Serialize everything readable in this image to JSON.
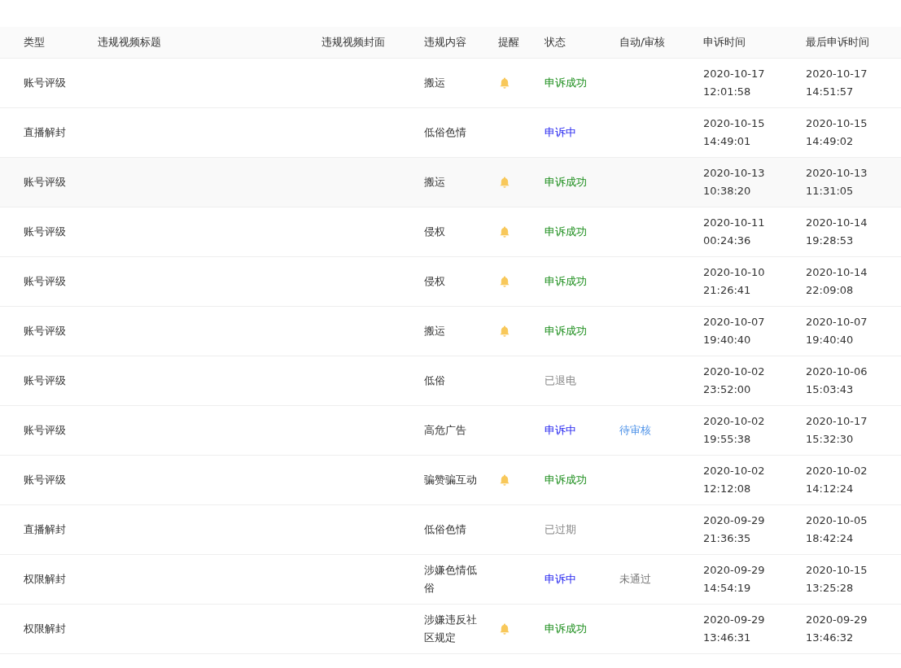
{
  "table": {
    "columns": [
      "类型",
      "违规视频标题",
      "违规视频封面",
      "违规内容",
      "提醒",
      "状态",
      "自动/审核",
      "申诉时间",
      "最后申诉时间"
    ],
    "rows": [
      {
        "type": "账号评级",
        "content": "搬运",
        "remind": true,
        "status": {
          "text": "申诉成功",
          "kind": "success"
        },
        "appeal_time": [
          "2020-10-17",
          "12:01:58"
        ],
        "last_time": [
          "2020-10-17",
          "14:51:57"
        ],
        "highlighted": false
      },
      {
        "type": "直播解封",
        "content": "低俗色情",
        "remind": false,
        "status": {
          "text": "申诉中",
          "kind": "pending"
        },
        "appeal_time": [
          "2020-10-15",
          "14:49:01"
        ],
        "last_time": [
          "2020-10-15",
          "14:49:02"
        ],
        "highlighted": false
      },
      {
        "type": "账号评级",
        "content": "搬运",
        "remind": true,
        "status": {
          "text": "申诉成功",
          "kind": "success"
        },
        "appeal_time": [
          "2020-10-13",
          "10:38:20"
        ],
        "last_time": [
          "2020-10-13",
          "11:31:05"
        ],
        "highlighted": true
      },
      {
        "type": "账号评级",
        "content": "侵权",
        "remind": true,
        "status": {
          "text": "申诉成功",
          "kind": "success"
        },
        "appeal_time": [
          "2020-10-11",
          "00:24:36"
        ],
        "last_time": [
          "2020-10-14",
          "19:28:53"
        ],
        "highlighted": false
      },
      {
        "type": "账号评级",
        "content": "侵权",
        "remind": true,
        "status": {
          "text": "申诉成功",
          "kind": "success"
        },
        "appeal_time": [
          "2020-10-10",
          "21:26:41"
        ],
        "last_time": [
          "2020-10-14",
          "22:09:08"
        ],
        "highlighted": false
      },
      {
        "type": "账号评级",
        "content": "搬运",
        "remind": true,
        "status": {
          "text": "申诉成功",
          "kind": "success"
        },
        "appeal_time": [
          "2020-10-07",
          "19:40:40"
        ],
        "last_time": [
          "2020-10-07",
          "19:40:40"
        ],
        "highlighted": false
      },
      {
        "type": "账号评级",
        "content": "低俗",
        "remind": false,
        "status": {
          "text": "已退电",
          "kind": "closed"
        },
        "appeal_time": [
          "2020-10-02",
          "23:52:00"
        ],
        "last_time": [
          "2020-10-06",
          "15:03:43"
        ],
        "highlighted": false
      },
      {
        "type": "账号评级",
        "content": "高危广告",
        "remind": false,
        "status": {
          "text": "申诉中",
          "kind": "pending"
        },
        "review": {
          "text": "待审核",
          "kind": "waiting"
        },
        "appeal_time": [
          "2020-10-02",
          "19:55:38"
        ],
        "last_time": [
          "2020-10-17",
          "15:32:30"
        ],
        "highlighted": false
      },
      {
        "type": "账号评级",
        "content": "骗赞骗互动",
        "remind": true,
        "status": {
          "text": "申诉成功",
          "kind": "success"
        },
        "appeal_time": [
          "2020-10-02",
          "12:12:08"
        ],
        "last_time": [
          "2020-10-02",
          "14:12:24"
        ],
        "highlighted": false
      },
      {
        "type": "直播解封",
        "content": "低俗色情",
        "remind": false,
        "status": {
          "text": "已过期",
          "kind": "closed"
        },
        "appeal_time": [
          "2020-09-29",
          "21:36:35"
        ],
        "last_time": [
          "2020-10-05",
          "18:42:24"
        ],
        "highlighted": false
      },
      {
        "type": "权限解封",
        "content": "涉嫌色情低俗",
        "remind": false,
        "status": {
          "text": "申诉中",
          "kind": "pending"
        },
        "review": {
          "text": "未通过",
          "kind": "rejected"
        },
        "appeal_time": [
          "2020-09-29",
          "14:54:19"
        ],
        "last_time": [
          "2020-10-15",
          "13:25:28"
        ],
        "highlighted": false
      },
      {
        "type": "权限解封",
        "content": "涉嫌违反社区规定",
        "remind": true,
        "status": {
          "text": "申诉成功",
          "kind": "success"
        },
        "appeal_time": [
          "2020-09-29",
          "13:46:31"
        ],
        "last_time": [
          "2020-09-29",
          "13:46:32"
        ],
        "highlighted": false
      }
    ]
  }
}
